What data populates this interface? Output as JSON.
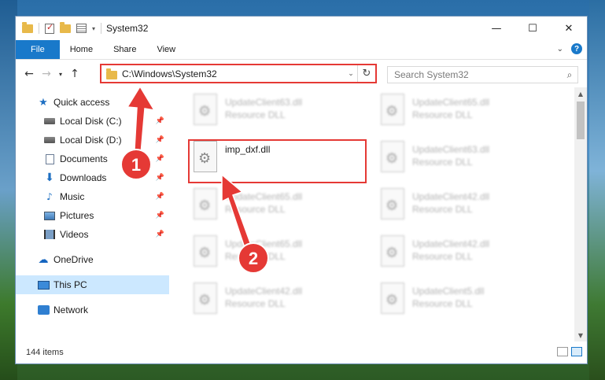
{
  "window": {
    "title": "System32",
    "controls": {
      "minimize": "—",
      "maximize": "☐",
      "close": "✕"
    }
  },
  "ribbon": {
    "tabs": [
      "File",
      "Home",
      "Share",
      "View"
    ],
    "expand_icon": "chevron-down",
    "help_label": "?"
  },
  "address": {
    "path": "C:\\Windows\\System32",
    "refresh_icon": "↻"
  },
  "search": {
    "placeholder": "Search System32"
  },
  "nav": {
    "items": [
      {
        "label": "Quick access",
        "icon": "star-icon",
        "pinned": false
      },
      {
        "label": "Local Disk (C:)",
        "icon": "disk-icon",
        "pinned": true
      },
      {
        "label": "Local Disk (D:)",
        "icon": "disk-icon",
        "pinned": true
      },
      {
        "label": "Documents",
        "icon": "documents-icon",
        "pinned": true
      },
      {
        "label": "Downloads",
        "icon": "downloads-icon",
        "pinned": true
      },
      {
        "label": "Music",
        "icon": "music-icon",
        "pinned": true
      },
      {
        "label": "Pictures",
        "icon": "pictures-icon",
        "pinned": true
      },
      {
        "label": "Videos",
        "icon": "videos-icon",
        "pinned": true
      },
      {
        "label": "OneDrive",
        "icon": "onedrive-icon",
        "pinned": false
      },
      {
        "label": "This PC",
        "icon": "this-pc-icon",
        "pinned": false,
        "selected": true
      },
      {
        "label": "Network",
        "icon": "network-icon",
        "pinned": false
      }
    ]
  },
  "files": [
    {
      "name": "UpdateClient63.dll",
      "desc": "Resource DLL"
    },
    {
      "name": "UpdateClient65.dll",
      "desc": "Resource DLL"
    },
    {
      "name": "imp_dxf.dll",
      "desc": ""
    },
    {
      "name": "UpdateClient63.dll",
      "desc": "Resource DLL"
    },
    {
      "name": "UpdateClient65.dll",
      "desc": "Resource DLL"
    },
    {
      "name": "UpdateClient42.dll",
      "desc": "Resource DLL"
    },
    {
      "name": "UpdateClient65.dll",
      "desc": "Resource DLL"
    },
    {
      "name": "UpdateClient42.dll",
      "desc": "Resource DLL"
    },
    {
      "name": "UpdateClient42.dll",
      "desc": "Resource DLL"
    },
    {
      "name": "UpdateClient5.dll",
      "desc": "Resource DLL"
    }
  ],
  "status": {
    "item_count": "144 items"
  },
  "annotations": {
    "step1": "1",
    "step2": "2",
    "color": "#e53935"
  }
}
